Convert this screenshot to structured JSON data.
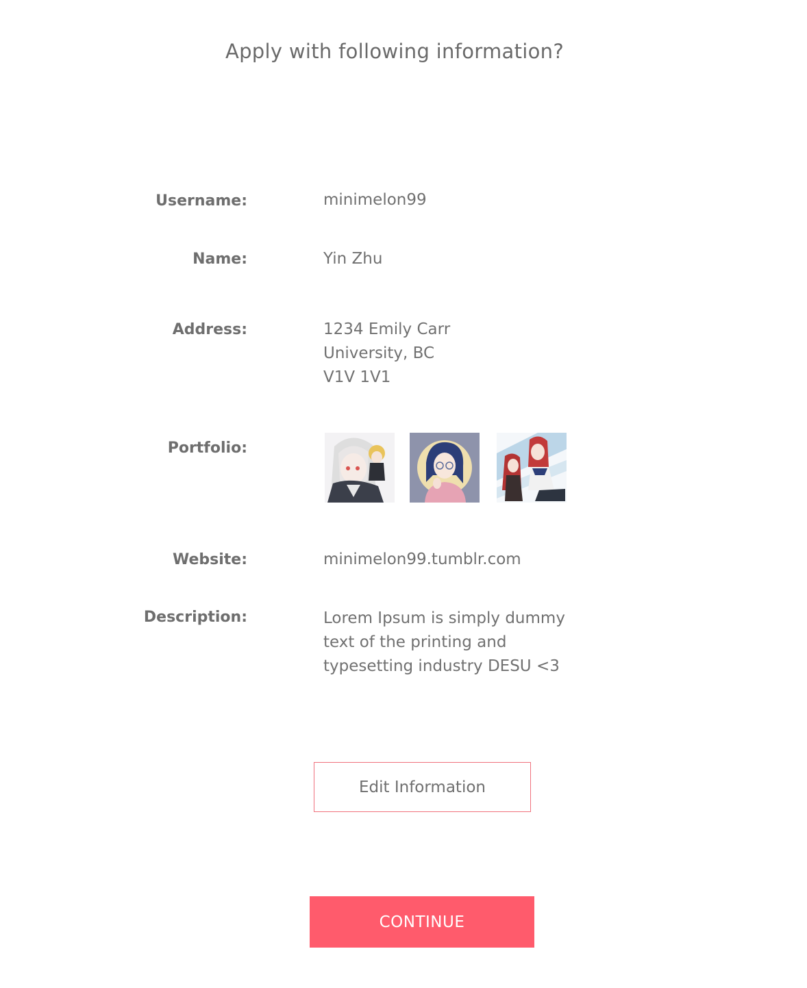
{
  "page": {
    "title": "Apply with following information?"
  },
  "fields": {
    "username": {
      "label": "Username:",
      "value": "minimelon99"
    },
    "name": {
      "label": "Name:",
      "value": "Yin Zhu"
    },
    "address": {
      "label": "Address:",
      "lines": [
        "1234 Emily Carr",
        "University, BC",
        "V1V 1V1"
      ]
    },
    "portfolio": {
      "label": "Portfolio:",
      "images": [
        "anime-girl-white-hair-thumbnail",
        "anime-girl-glasses-thumbnail",
        "anime-girls-red-hair-thumbnail"
      ]
    },
    "website": {
      "label": "Website:",
      "value": "minimelon99.tumblr.com"
    },
    "description": {
      "label": "Description:",
      "lines": [
        "Lorem Ipsum is simply dummy",
        "text of the printing and",
        "typesetting industry DESU <3"
      ]
    }
  },
  "actions": {
    "edit_label": "Edit Information",
    "continue_label": "CONTINUE"
  },
  "colors": {
    "accent": "#ff5b6c",
    "edit_border": "#f0707c",
    "text": "#707070"
  }
}
